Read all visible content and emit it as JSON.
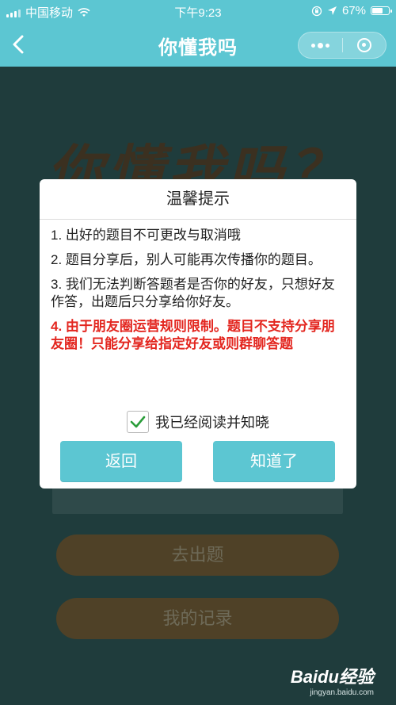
{
  "status_bar": {
    "carrier": "中国移动",
    "time": "下午9:23",
    "battery": "67%",
    "battery_level": 0.67
  },
  "nav": {
    "title": "你懂我吗"
  },
  "background": {
    "headline": "你懂我吗？",
    "button_create": "去出题",
    "button_records": "我的记录"
  },
  "modal": {
    "title": "温馨提示",
    "rules": [
      "1. 出好的题目不可更改与取消哦",
      "2. 题目分享后，别人可能再次传播你的题目。",
      "3. 我们无法判断答题者是否你的好友，只想好友作答，出题后只分享给你好友。",
      "4. 由于朋友圈运营规则限制。题目不支持分享朋友圈！只能分享给指定好友或则群聊答题"
    ],
    "checkbox_label": "我已经阅读并知晓",
    "checkbox_checked": true,
    "button_back": "返回",
    "button_ok": "知道了"
  },
  "watermark": {
    "logo": "Baidu经验",
    "url": "jingyan.baidu.com"
  },
  "colors": {
    "accent": "#5cc6d2",
    "warning_text": "#e3261f",
    "check_green": "#2a9d3a"
  }
}
